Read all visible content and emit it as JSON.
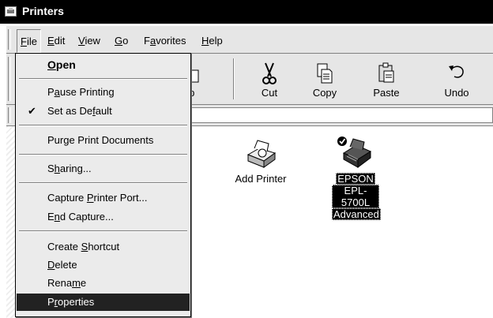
{
  "window": {
    "title": "Printers"
  },
  "menubar": {
    "items": [
      {
        "id": "file",
        "label": "File",
        "accel": "F"
      },
      {
        "id": "edit",
        "label": "Edit",
        "accel": "E"
      },
      {
        "id": "view",
        "label": "View",
        "accel": "V"
      },
      {
        "id": "go",
        "label": "Go",
        "accel": "G"
      },
      {
        "id": "favorites",
        "label": "Favorites",
        "accel": "a"
      },
      {
        "id": "help",
        "label": "Help",
        "accel": "H"
      }
    ]
  },
  "toolbar": {
    "buttons": [
      {
        "id": "up",
        "label": "Up",
        "icon": "folder-up-icon"
      },
      {
        "id": "cut",
        "label": "Cut",
        "icon": "scissors-icon"
      },
      {
        "id": "copy",
        "label": "Copy",
        "icon": "copy-icon"
      },
      {
        "id": "paste",
        "label": "Paste",
        "icon": "paste-icon"
      },
      {
        "id": "undo",
        "label": "Undo",
        "icon": "undo-icon"
      }
    ]
  },
  "content": {
    "icons": [
      {
        "id": "add-printer",
        "label": "Add Printer",
        "selected": false,
        "icon": "add-printer-icon"
      },
      {
        "id": "epson",
        "label_lines": [
          "EPSON",
          "EPL-5700L",
          "Advanced"
        ],
        "selected": true,
        "default": true,
        "icon": "printer-icon"
      }
    ]
  },
  "file_menu": {
    "items": [
      {
        "id": "open",
        "label": "Open",
        "accel": "O",
        "bold": true
      },
      {
        "type": "sep"
      },
      {
        "id": "pause",
        "label": "Pause Printing",
        "accel": "a"
      },
      {
        "id": "default",
        "label": "Set as Default",
        "accel": "f",
        "checked": true
      },
      {
        "type": "sep"
      },
      {
        "id": "purge",
        "label": "Purge Print Documents",
        "accel": "g"
      },
      {
        "type": "sep"
      },
      {
        "id": "sharing",
        "label": "Sharing...",
        "accel": "h"
      },
      {
        "type": "sep"
      },
      {
        "id": "capture",
        "label": "Capture Printer Port...",
        "accel": "P"
      },
      {
        "id": "endcapture",
        "label": "End Capture...",
        "accel": "n"
      },
      {
        "type": "sep"
      },
      {
        "id": "shortcut",
        "label": "Create Shortcut",
        "accel": "S"
      },
      {
        "id": "delete",
        "label": "Delete",
        "accel": "D"
      },
      {
        "id": "rename",
        "label": "Rename",
        "accel": "m"
      },
      {
        "id": "properties",
        "label": "Properties",
        "accel": "r",
        "highlighted": true
      }
    ]
  }
}
